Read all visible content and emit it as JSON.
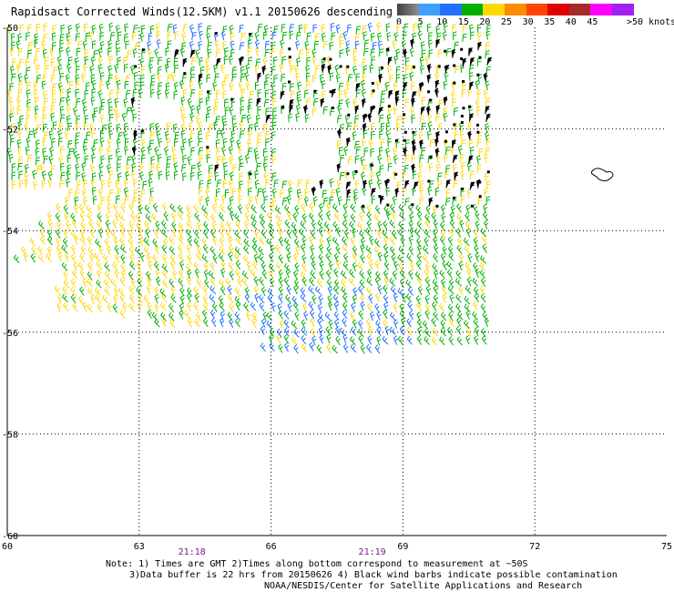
{
  "title": "Rapidsact Corrected Winds(12.5KM) v1.1 20150626 descending",
  "legend": {
    "colors": [
      "#7f7f7f",
      "#3fa0ff",
      "#1f70ff",
      "#00b000",
      "#ffd700",
      "#ff8c00",
      "#ff4500",
      "#e00000",
      "#a52a2a",
      "#ff00ff",
      "#a020f0"
    ],
    "gray_ramp": [
      "#404040",
      "#909090"
    ],
    "labels": [
      "0",
      "5",
      "10",
      "15",
      "20",
      "25",
      "30",
      "35",
      "40",
      "45"
    ],
    "unit_label": ">50 knots"
  },
  "axes": {
    "x_ticks": [
      "60",
      "63",
      "66",
      "69",
      "72",
      "75"
    ],
    "y_ticks": [
      "-50",
      "-52",
      "-54",
      "-56",
      "-58",
      "-60"
    ],
    "x_range": [
      60,
      75
    ],
    "y_range": [
      -60,
      -50
    ],
    "grid": true
  },
  "time_labels": [
    {
      "text": "21:18",
      "lon": 64.2
    },
    {
      "text": "21:19",
      "lon": 68.3
    }
  ],
  "notes": [
    "Note: 1) Times are GMT 2)Times along bottom correspond to measurement at ~50S",
    "3)Data buffer is 22 hrs from 20150626 4) Black wind barbs indicate possible contamination",
    "NOAA/NESDIS/Center for Satellite Applications and Research"
  ]
}
